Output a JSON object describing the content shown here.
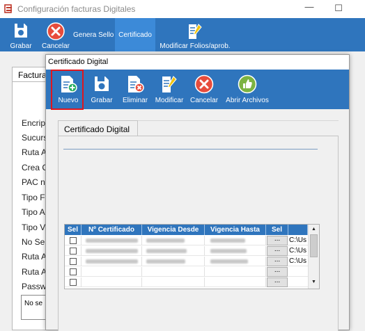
{
  "main_window": {
    "title": "Configuración facturas Digitales",
    "minimize_glyph": "—",
    "maximize_glyph": "☐",
    "toolbar": {
      "grabar": "Grabar",
      "cancelar": "Cancelar",
      "genera_sello": "Genera Sello",
      "certificado": "Certificado",
      "modificar_folios": "Modificar Folios/aprob."
    },
    "tab_label": "Factura",
    "field_labels": [
      "Encript",
      "Sucurs",
      "Ruta A",
      "Crea C",
      "PAC no",
      "Tipo F",
      "Tipo A",
      "Tipo V",
      "No Sell",
      "Ruta A",
      "Ruta A",
      "Passwo"
    ],
    "note_text": "No se"
  },
  "dialog": {
    "title": "Certificado Digital",
    "toolbar": {
      "nuevo": "Nuevo",
      "grabar": "Grabar",
      "eliminar": "Eliminar",
      "modificar": "Modificar",
      "cancelar": "Cancelar",
      "abrir_archivos": "Abrir Archivos"
    },
    "tab_label": "Certificado Digital",
    "grid": {
      "columns": [
        "Sel",
        "Nº Certificado",
        "Vigencia Desde",
        "Vigencia Hasta",
        "Sel",
        ""
      ],
      "rows": [
        {
          "checked": false,
          "has_data": true,
          "button": "...",
          "path": "C:\\Us"
        },
        {
          "checked": false,
          "has_data": true,
          "button": "...",
          "path": "C:\\Us"
        },
        {
          "checked": false,
          "has_data": true,
          "button": "...",
          "path": "C:\\Us"
        },
        {
          "checked": false,
          "has_data": false,
          "button": "...",
          "path": ""
        },
        {
          "checked": false,
          "has_data": false,
          "button": "...",
          "path": ""
        }
      ]
    }
  },
  "colors": {
    "toolbar_blue": "#2f75bd",
    "highlight_red": "#e0161d",
    "app_icon_red": "#c0392b"
  }
}
